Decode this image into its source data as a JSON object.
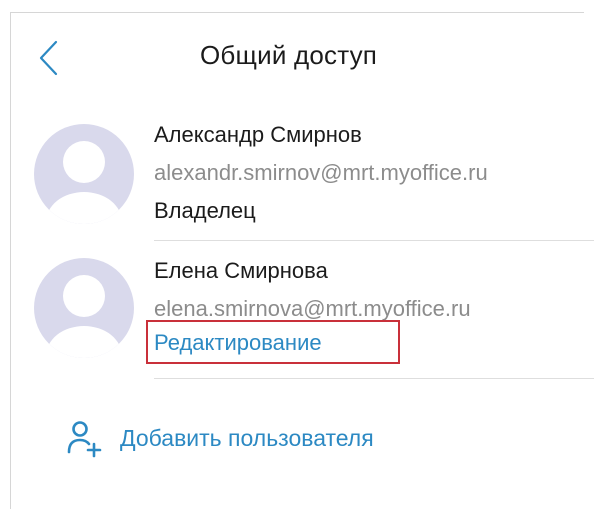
{
  "header": {
    "title": "Общий доступ",
    "back_icon": "chevron-left-icon"
  },
  "users": [
    {
      "name": "Александр Смирнов",
      "email": "alexandr.smirnov@mrt.myoffice.ru",
      "role": "Владелец"
    },
    {
      "name": "Елена Смирнова",
      "email": "elena.smirnova@mrt.myoffice.ru",
      "role": "Редактирование"
    }
  ],
  "add_user": {
    "label": "Добавить пользователя",
    "icon": "add-user-icon"
  },
  "colors": {
    "accent": "#2c89c3",
    "avatar": "#d9d9ec",
    "highlight": "#c9303a"
  }
}
